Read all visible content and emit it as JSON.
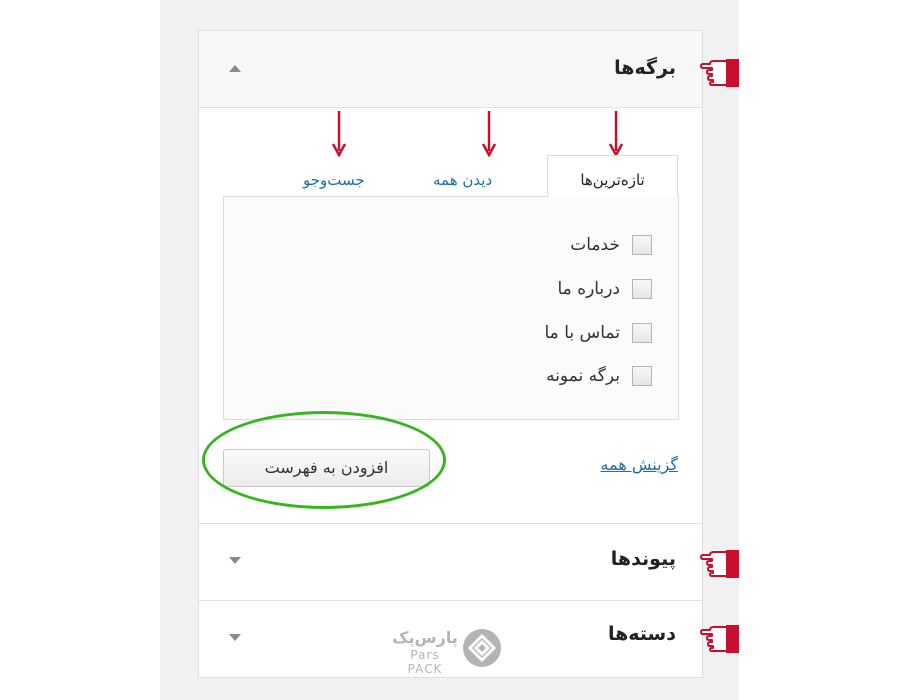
{
  "sections": {
    "pages": {
      "title": "برگه‌ها",
      "expanded": true
    },
    "links": {
      "title": "پیوندها",
      "expanded": false
    },
    "categories": {
      "title": "دسته‌ها",
      "expanded": false
    }
  },
  "tabs": [
    {
      "label": "تازه‌ترین‌ها",
      "active": true
    },
    {
      "label": "دیدن همه",
      "active": false
    },
    {
      "label": "جست‌وجو",
      "active": false
    }
  ],
  "items": [
    {
      "label": "خدمات",
      "checked": false
    },
    {
      "label": "درباره ما",
      "checked": false
    },
    {
      "label": "تماس با ما",
      "checked": false
    },
    {
      "label": "برگه نمونه",
      "checked": false
    }
  ],
  "select_all_label": "گزینش همه",
  "add_to_menu_label": "افزودن به فهرست",
  "watermark": {
    "fa": "پارس‌پک",
    "en": "Pars PACK"
  },
  "colors": {
    "accent_red": "#c8102e",
    "highlight_green": "#36b51e",
    "link_blue": "#1b6ea7"
  },
  "icons": [
    "pointing-hand-icon",
    "down-arrow-icon",
    "collapse-arrow-icon",
    "expand-arrow-icon",
    "parspack-logo-icon"
  ]
}
